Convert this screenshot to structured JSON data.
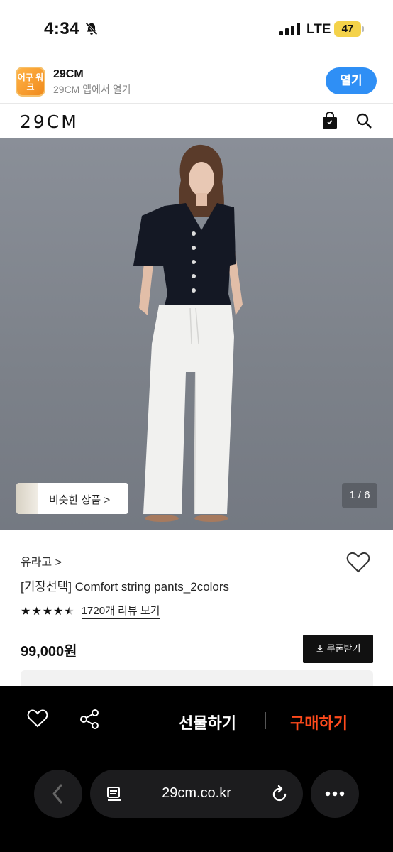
{
  "status_bar": {
    "time": "4:34",
    "network": "LTE",
    "battery": "47"
  },
  "app_banner": {
    "icon_text": "어구 워크",
    "name": "29CM",
    "subtitle": "29CM 앱에서 열기",
    "open_label": "열기"
  },
  "header": {
    "logo": "29CM"
  },
  "hero": {
    "similar_label": "비슷한 상품 >",
    "image_counter": "1 / 6"
  },
  "product": {
    "brand": "유라고 >",
    "title": "[기장선택] Comfort string pants_2colors",
    "rating": 4.5,
    "review_link": "1720개 리뷰 보기",
    "price": "99,000원",
    "coupon_label": "쿠폰받기"
  },
  "action_bar": {
    "gift_label": "선물하기",
    "buy_label": "구매하기",
    "buy_color": "#ff4a1c"
  },
  "browser": {
    "url": "29cm.co.kr"
  },
  "icons": [
    "bell-slash-icon",
    "signal-icon",
    "battery-icon",
    "shopping-bag-icon",
    "search-icon",
    "heart-icon",
    "share-icon",
    "back-arrow-icon",
    "reader-icon",
    "reload-icon",
    "more-icon",
    "download-icon"
  ]
}
